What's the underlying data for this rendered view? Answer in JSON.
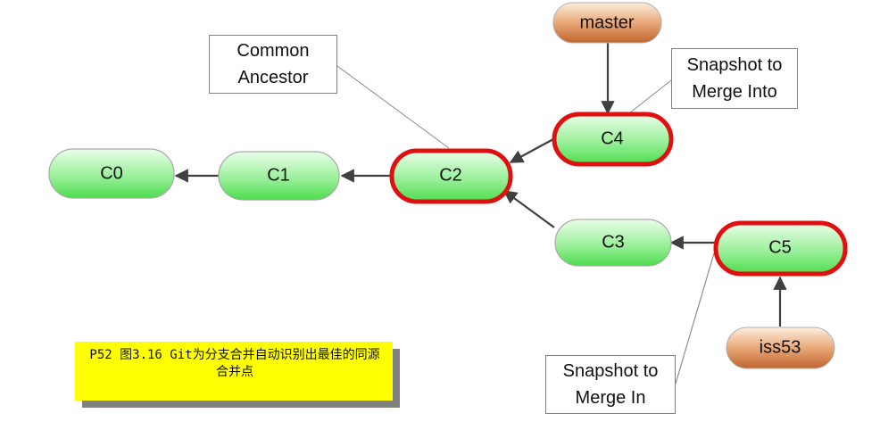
{
  "commits": [
    {
      "id": "c0",
      "label": "C0",
      "highlighted": false
    },
    {
      "id": "c1",
      "label": "C1",
      "highlighted": false
    },
    {
      "id": "c2",
      "label": "C2",
      "highlighted": true
    },
    {
      "id": "c3",
      "label": "C3",
      "highlighted": false
    },
    {
      "id": "c4",
      "label": "C4",
      "highlighted": true
    },
    {
      "id": "c5",
      "label": "C5",
      "highlighted": true
    }
  ],
  "branches": [
    {
      "id": "master",
      "label": "master",
      "points_to": "C4"
    },
    {
      "id": "iss53",
      "label": "iss53",
      "points_to": "C5"
    }
  ],
  "edges": [
    {
      "from": "C1",
      "to": "C0"
    },
    {
      "from": "C2",
      "to": "C1"
    },
    {
      "from": "C4",
      "to": "C2"
    },
    {
      "from": "C3",
      "to": "C2"
    },
    {
      "from": "C5",
      "to": "C3"
    }
  ],
  "callouts": {
    "common_ancestor": {
      "line1": "Common",
      "line2": "Ancestor",
      "target": "C2"
    },
    "merge_into": {
      "line1": "Snapshot to",
      "line2": "Merge Into",
      "target": "C4"
    },
    "merge_in": {
      "line1": "Snapshot to",
      "line2": "Merge In",
      "target": "C5"
    }
  },
  "caption": "P52 图3.16 Git为分支合并自动识别出最佳的同源合并点",
  "colors": {
    "commit_fill_top": "#eaffea",
    "commit_fill_bottom": "#55e055",
    "commit_border": "#aaaaaa",
    "highlight_border": "#e01010",
    "branch_fill_top": "#fbe6d0",
    "branch_fill_bottom": "#c8703a",
    "arrow": "#404040",
    "caption_background": "#ffff00"
  }
}
